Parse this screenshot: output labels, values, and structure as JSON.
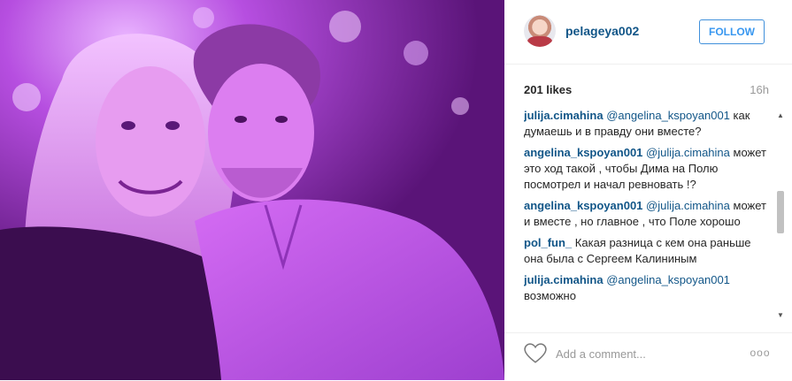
{
  "post": {
    "photo_label": "",
    "author": {
      "username": "pelageya002"
    },
    "follow_label": "FOLLOW",
    "likes": "201 likes",
    "time": "16h"
  },
  "comments": [
    {
      "user": "julija.cimahina",
      "mention": "@angelina_kspoyan001",
      "text": "как думаешь и в правду они вместе?"
    },
    {
      "user": "angelina_kspoyan001",
      "mention": "@julija.cimahina",
      "text": "может это ход такой , чтобы Дима на Полю посмотрел и начал ревновать !?"
    },
    {
      "user": "angelina_kspoyan001",
      "mention": "@julija.cimahina",
      "text": "может и вместе , но главное , что Поле хорошо"
    },
    {
      "user": "pol_fun_",
      "mention": "",
      "text": "Какая разница с кем она раньше она была с Сергеем Калининым"
    },
    {
      "user": "julija.cimahina",
      "mention": "@angelina_kspoyan001",
      "text": "возможно"
    }
  ],
  "footer": {
    "placeholder": "Add a comment...",
    "more_label": "ooo"
  },
  "icons": {
    "like": "heart-icon",
    "more": "more-options-icon",
    "scroll_up": "scroll-up-arrow",
    "scroll_down": "scroll-down-arrow"
  },
  "colors": {
    "link": "#125688",
    "follow": "#3897f0",
    "muted": "#999999",
    "photo_tint": "#9b2fc4"
  }
}
